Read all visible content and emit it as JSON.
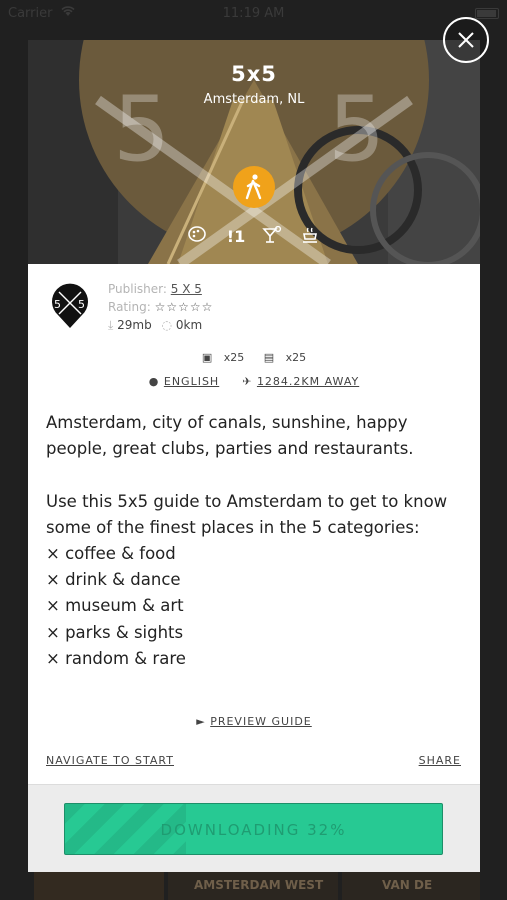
{
  "status_bar": {
    "carrier": "Carrier",
    "time": "11:19 AM"
  },
  "hero": {
    "title": "5x5",
    "location": "Amsterdam, NL"
  },
  "publisher": {
    "label": "Publisher:",
    "name": "5 X 5"
  },
  "rating": {
    "label": "Rating:",
    "stars": "☆☆☆☆☆",
    "value_of_5": 0
  },
  "size": "29mb",
  "distance_short": "0km",
  "counts": {
    "photos": "x25",
    "pages": "x25"
  },
  "language": "ENGLISH",
  "away": "1284.2KM AWAY",
  "description": "Amsterdam, city of canals, sunshine, happy people, great clubs, parties and restaurants.\n\nUse this 5x5 guide to Amsterdam to get to know some of the finest places in the 5 categories:\n× coffee & food\n× drink & dance\n× museum & art\n× parks & sights\n× random & rare",
  "preview_label": "PREVIEW GUIDE",
  "navigate_label": "NAVIGATE TO START",
  "share_label": "SHARE",
  "download": {
    "label": "DOWNLOADING 32%",
    "progress": 0.32
  },
  "background_tiles": {
    "tile2": "AMSTERDAM WEST",
    "tile3": "VAN DE"
  },
  "colors": {
    "accent": "#27c993",
    "badge": "#f0a21a"
  }
}
